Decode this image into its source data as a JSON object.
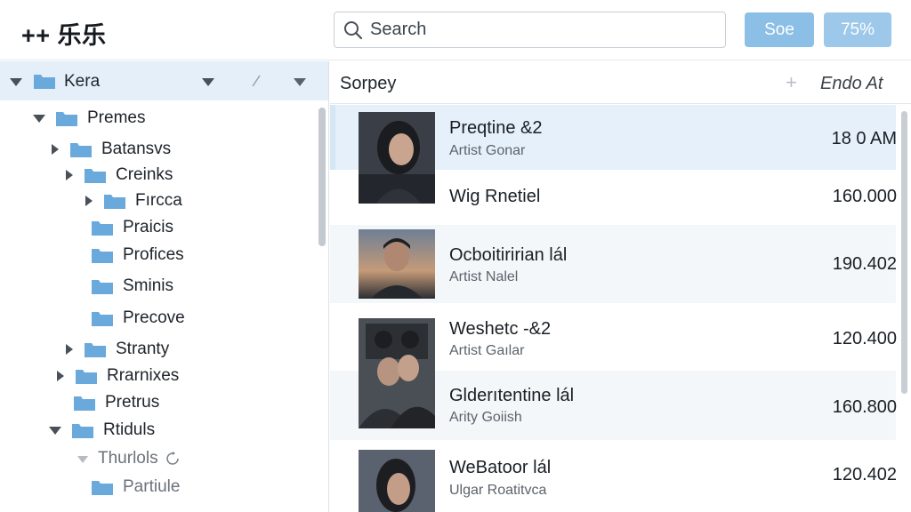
{
  "app": {
    "title": "++ 乐乐"
  },
  "search": {
    "placeholder": "Search",
    "value": ""
  },
  "toolbar": {
    "save_label": "Soe",
    "zoom_label": "75%"
  },
  "tree": {
    "root_label": "Kera",
    "items": [
      {
        "label": "Premes",
        "expanded": true
      },
      {
        "label": "Batansvs",
        "expanded": false
      },
      {
        "label": "Creinks",
        "expanded": false
      },
      {
        "label": "Fırcca",
        "expanded": false
      },
      {
        "label": "Praicis"
      },
      {
        "label": "Profices"
      },
      {
        "label": "Sminis"
      },
      {
        "label": "Precove"
      },
      {
        "label": "Stranty",
        "expanded": false
      },
      {
        "label": "Rrarnixes",
        "expanded": false
      },
      {
        "label": "Pretrus"
      },
      {
        "label": "Rtiduls",
        "expanded": true
      },
      {
        "label": "Thurlols"
      },
      {
        "label": "Partiule"
      }
    ]
  },
  "list": {
    "header": {
      "title": "Sorpey",
      "end_label": "Endo At"
    },
    "rows": [
      {
        "title": "Preqtine &2",
        "artist": "Artist Gonar",
        "value": "18 0 AM",
        "selected": true
      },
      {
        "title": "Wig Rnetiel",
        "artist": "",
        "value": "160.000"
      },
      {
        "title": "Ocboitiririan lál",
        "artist": "Artist Nalel",
        "value": "190.402"
      },
      {
        "title": "Weshetc -&2",
        "artist": "Artist Gaılar",
        "value": "120.400"
      },
      {
        "title": "Glderıtentine lál",
        "artist": "Arity Goiish",
        "value": "160.800"
      },
      {
        "title": "WeBatoor lál",
        "artist": "Ulgar Roatitvca",
        "value": "120.402"
      }
    ]
  },
  "colors": {
    "accent": "#8cbfe6",
    "selection": "#e5f0fa",
    "folder": "#6aa9dc"
  }
}
